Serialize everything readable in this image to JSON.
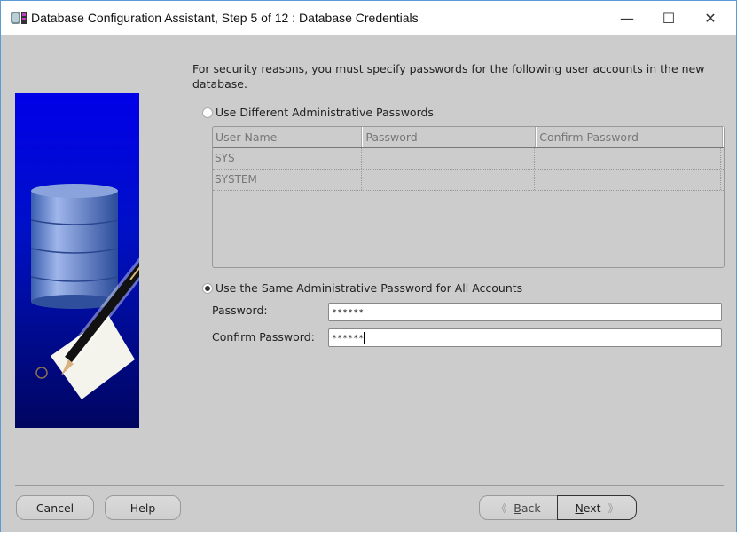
{
  "window": {
    "title": "Database Configuration Assistant, Step 5 of 12 : Database Credentials",
    "icon": "database-app-icon",
    "controls": {
      "minimize": "—",
      "maximize": "☐",
      "close": "✕"
    }
  },
  "banner": {
    "icon": "database-pen-illustration"
  },
  "intro_text": "For security reasons, you must specify passwords for the following user accounts in the new database.",
  "options": {
    "different": {
      "label": "Use Different Administrative Passwords",
      "selected": false
    },
    "same": {
      "label": "Use the Same Administrative Password for All Accounts",
      "selected": true
    }
  },
  "table": {
    "columns": [
      "User Name",
      "Password",
      "Confirm Password"
    ],
    "rows": [
      {
        "user": "SYS",
        "password": "",
        "confirm": ""
      },
      {
        "user": "SYSTEM",
        "password": "",
        "confirm": ""
      }
    ]
  },
  "fields": {
    "password": {
      "label": "Password:",
      "value": "******"
    },
    "confirm": {
      "label": "Confirm Password:",
      "value": "******"
    }
  },
  "buttons": {
    "cancel": "Cancel",
    "help": "Help",
    "back_prefix": "",
    "back_mnemonic": "B",
    "back_rest": "ack",
    "next_mnemonic": "N",
    "next_rest": "ext",
    "back_chevron": "《",
    "next_chevron": "》"
  }
}
